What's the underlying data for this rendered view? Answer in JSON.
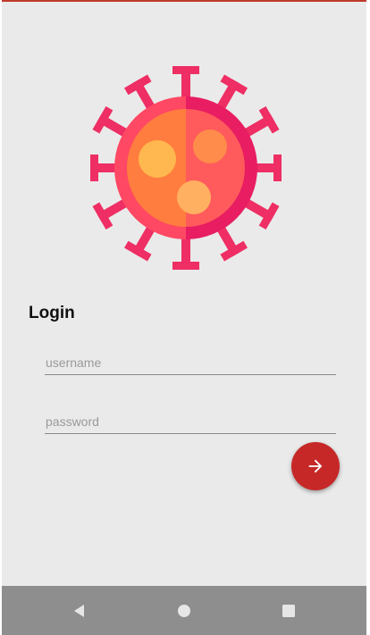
{
  "login": {
    "title": "Login",
    "username_placeholder": "username",
    "password_placeholder": "password",
    "submit_icon": "arrow-right-icon"
  },
  "logo": {
    "icon": "virus-icon",
    "colors": {
      "spike": "#e51d66",
      "body_left": "#ff7a3d",
      "body_right": "#ff4f6a",
      "spots": "#ffb74d"
    }
  },
  "navbar": {
    "icons": [
      "back-icon",
      "home-icon",
      "recents-icon"
    ]
  },
  "colors": {
    "accent": "#c62828",
    "background": "#eaeaea",
    "navbar": "#8e8e8e"
  }
}
